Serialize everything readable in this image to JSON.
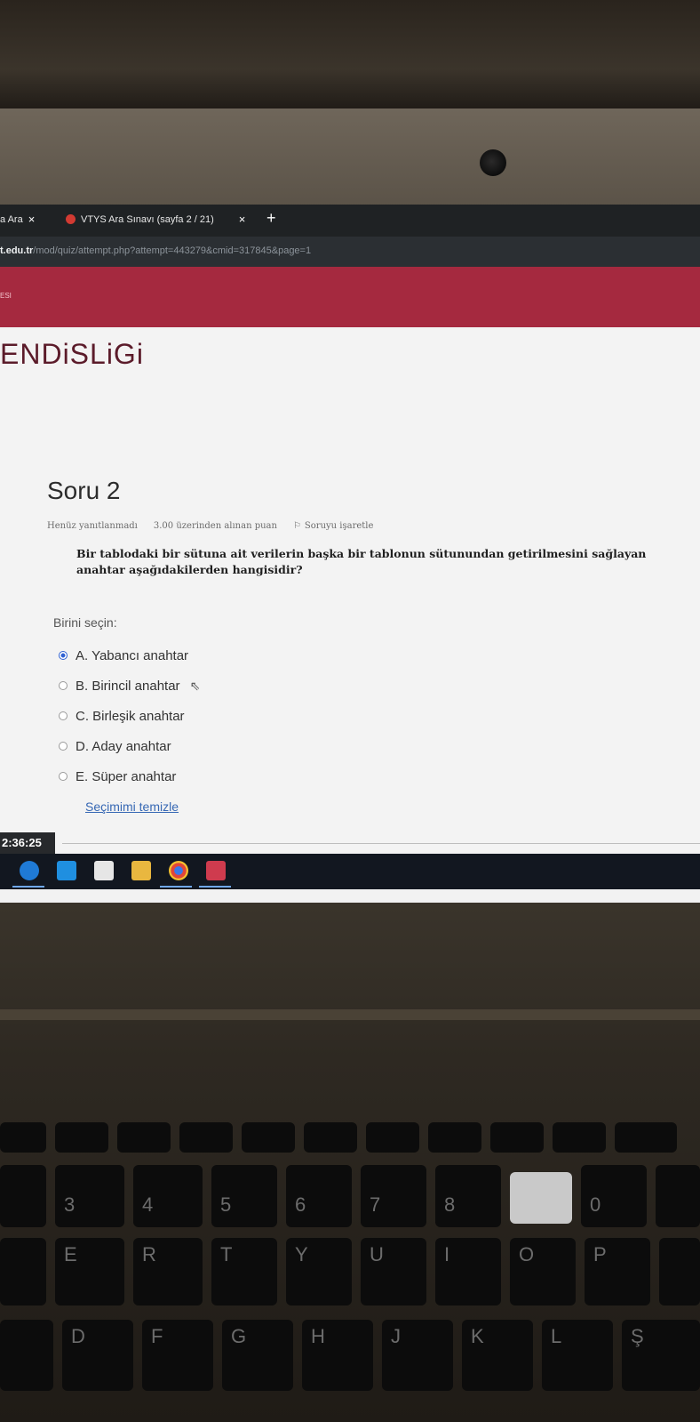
{
  "browser": {
    "tabs": [
      {
        "label": "a Ara",
        "close": "×"
      },
      {
        "label": "VTYS Ara Sınavı (sayfa 2 / 21)",
        "close": "×"
      }
    ],
    "new_tab": "+",
    "url_domain": "t.edu.tr",
    "url_path": "/mod/quiz/attempt.php?attempt=443279&cmid=317845&page=1"
  },
  "site": {
    "header_mini": "ESI",
    "course_title": "ENDiSLiGi"
  },
  "question": {
    "title": "Soru 2",
    "status": "Henüz yanıtlanmadı",
    "points": "3.00 üzerinden alınan puan",
    "flag_label": "Soruyu işaretle",
    "text": "Bir tablodaki bir sütuna ait verilerin başka bir tablonun sütunundan getirilmesini sağlayan anahtar aşağıdakilerden hangisidir?",
    "choose_label": "Birini seçin:",
    "options": [
      {
        "label": "A. Yabancı anahtar",
        "selected": true
      },
      {
        "label": "B. Birincil anahtar",
        "selected": false
      },
      {
        "label": "C. Birleşik anahtar",
        "selected": false
      },
      {
        "label": "D. Aday anahtar",
        "selected": false
      },
      {
        "label": "E. Süper anahtar",
        "selected": false
      }
    ],
    "clear_label": "Seçimimi temizle"
  },
  "timer": "2:36:25",
  "taskbar_icons": [
    "edge-icon",
    "mail-icon",
    "store-icon",
    "folder-icon",
    "chrome-icon",
    "media-icon"
  ],
  "keyboard": {
    "number_row": [
      "3",
      "4",
      "5",
      "6",
      "7",
      "8",
      "0"
    ],
    "top_row": [
      "E",
      "R",
      "T",
      "Y",
      "U",
      "I",
      "O",
      "P"
    ],
    "home_row": [
      "D",
      "F",
      "G",
      "H",
      "J",
      "K",
      "L",
      "Ş"
    ]
  }
}
